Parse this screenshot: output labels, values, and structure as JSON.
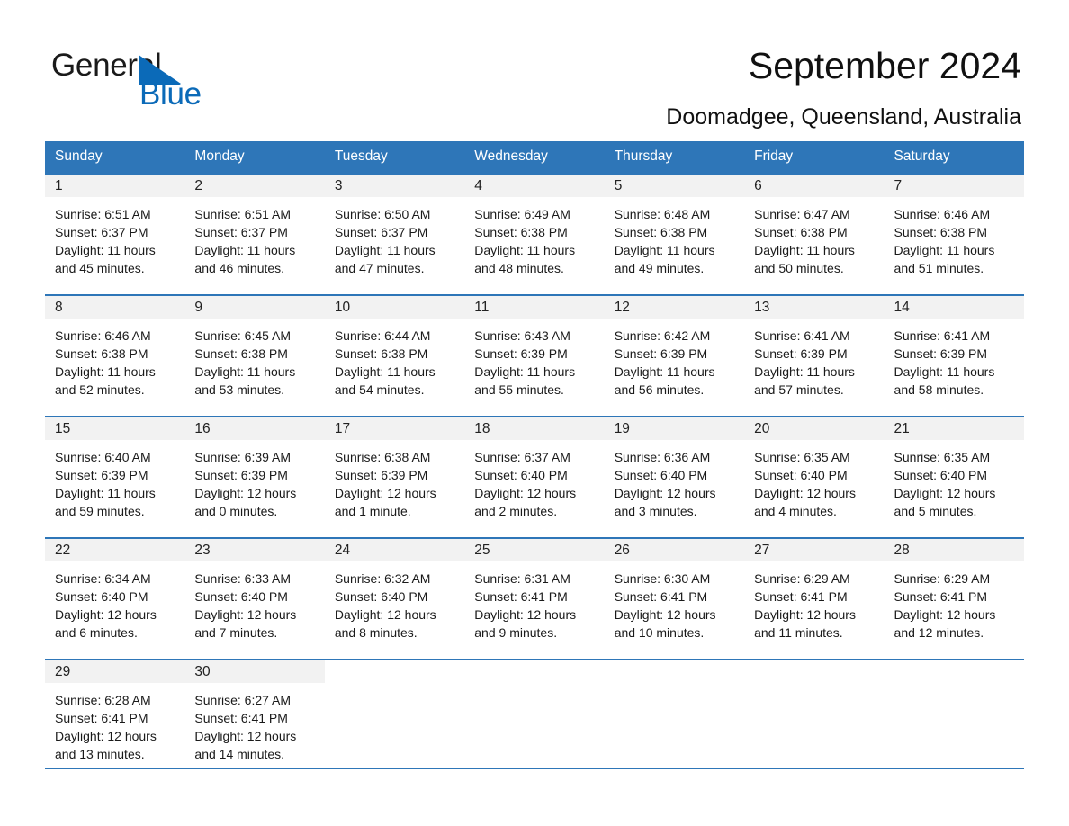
{
  "brand": {
    "word1": "General",
    "word2": "Blue",
    "triangle_color": "#0b6ab8",
    "text_color": "#1a1a1a"
  },
  "header": {
    "title": "September 2024",
    "subtitle": "Doomadgee, Queensland, Australia"
  },
  "theme": {
    "header_blue": "#2e76b8",
    "daynum_bg": "#f2f2f2",
    "page_bg": "#ffffff"
  },
  "weekdays": [
    "Sunday",
    "Monday",
    "Tuesday",
    "Wednesday",
    "Thursday",
    "Friday",
    "Saturday"
  ],
  "labels": {
    "sunrise_prefix": "Sunrise:",
    "sunset_prefix": "Sunset:",
    "daylight_prefix": "Daylight:"
  },
  "weeks": [
    [
      {
        "day": "1",
        "sunrise": "Sunrise: 6:51 AM",
        "sunset": "Sunset: 6:37 PM",
        "daylight_line1": "Daylight: 11 hours",
        "daylight_line2": "and 45 minutes."
      },
      {
        "day": "2",
        "sunrise": "Sunrise: 6:51 AM",
        "sunset": "Sunset: 6:37 PM",
        "daylight_line1": "Daylight: 11 hours",
        "daylight_line2": "and 46 minutes."
      },
      {
        "day": "3",
        "sunrise": "Sunrise: 6:50 AM",
        "sunset": "Sunset: 6:37 PM",
        "daylight_line1": "Daylight: 11 hours",
        "daylight_line2": "and 47 minutes."
      },
      {
        "day": "4",
        "sunrise": "Sunrise: 6:49 AM",
        "sunset": "Sunset: 6:38 PM",
        "daylight_line1": "Daylight: 11 hours",
        "daylight_line2": "and 48 minutes."
      },
      {
        "day": "5",
        "sunrise": "Sunrise: 6:48 AM",
        "sunset": "Sunset: 6:38 PM",
        "daylight_line1": "Daylight: 11 hours",
        "daylight_line2": "and 49 minutes."
      },
      {
        "day": "6",
        "sunrise": "Sunrise: 6:47 AM",
        "sunset": "Sunset: 6:38 PM",
        "daylight_line1": "Daylight: 11 hours",
        "daylight_line2": "and 50 minutes."
      },
      {
        "day": "7",
        "sunrise": "Sunrise: 6:46 AM",
        "sunset": "Sunset: 6:38 PM",
        "daylight_line1": "Daylight: 11 hours",
        "daylight_line2": "and 51 minutes."
      }
    ],
    [
      {
        "day": "8",
        "sunrise": "Sunrise: 6:46 AM",
        "sunset": "Sunset: 6:38 PM",
        "daylight_line1": "Daylight: 11 hours",
        "daylight_line2": "and 52 minutes."
      },
      {
        "day": "9",
        "sunrise": "Sunrise: 6:45 AM",
        "sunset": "Sunset: 6:38 PM",
        "daylight_line1": "Daylight: 11 hours",
        "daylight_line2": "and 53 minutes."
      },
      {
        "day": "10",
        "sunrise": "Sunrise: 6:44 AM",
        "sunset": "Sunset: 6:38 PM",
        "daylight_line1": "Daylight: 11 hours",
        "daylight_line2": "and 54 minutes."
      },
      {
        "day": "11",
        "sunrise": "Sunrise: 6:43 AM",
        "sunset": "Sunset: 6:39 PM",
        "daylight_line1": "Daylight: 11 hours",
        "daylight_line2": "and 55 minutes."
      },
      {
        "day": "12",
        "sunrise": "Sunrise: 6:42 AM",
        "sunset": "Sunset: 6:39 PM",
        "daylight_line1": "Daylight: 11 hours",
        "daylight_line2": "and 56 minutes."
      },
      {
        "day": "13",
        "sunrise": "Sunrise: 6:41 AM",
        "sunset": "Sunset: 6:39 PM",
        "daylight_line1": "Daylight: 11 hours",
        "daylight_line2": "and 57 minutes."
      },
      {
        "day": "14",
        "sunrise": "Sunrise: 6:41 AM",
        "sunset": "Sunset: 6:39 PM",
        "daylight_line1": "Daylight: 11 hours",
        "daylight_line2": "and 58 minutes."
      }
    ],
    [
      {
        "day": "15",
        "sunrise": "Sunrise: 6:40 AM",
        "sunset": "Sunset: 6:39 PM",
        "daylight_line1": "Daylight: 11 hours",
        "daylight_line2": "and 59 minutes."
      },
      {
        "day": "16",
        "sunrise": "Sunrise: 6:39 AM",
        "sunset": "Sunset: 6:39 PM",
        "daylight_line1": "Daylight: 12 hours",
        "daylight_line2": "and 0 minutes."
      },
      {
        "day": "17",
        "sunrise": "Sunrise: 6:38 AM",
        "sunset": "Sunset: 6:39 PM",
        "daylight_line1": "Daylight: 12 hours",
        "daylight_line2": "and 1 minute."
      },
      {
        "day": "18",
        "sunrise": "Sunrise: 6:37 AM",
        "sunset": "Sunset: 6:40 PM",
        "daylight_line1": "Daylight: 12 hours",
        "daylight_line2": "and 2 minutes."
      },
      {
        "day": "19",
        "sunrise": "Sunrise: 6:36 AM",
        "sunset": "Sunset: 6:40 PM",
        "daylight_line1": "Daylight: 12 hours",
        "daylight_line2": "and 3 minutes."
      },
      {
        "day": "20",
        "sunrise": "Sunrise: 6:35 AM",
        "sunset": "Sunset: 6:40 PM",
        "daylight_line1": "Daylight: 12 hours",
        "daylight_line2": "and 4 minutes."
      },
      {
        "day": "21",
        "sunrise": "Sunrise: 6:35 AM",
        "sunset": "Sunset: 6:40 PM",
        "daylight_line1": "Daylight: 12 hours",
        "daylight_line2": "and 5 minutes."
      }
    ],
    [
      {
        "day": "22",
        "sunrise": "Sunrise: 6:34 AM",
        "sunset": "Sunset: 6:40 PM",
        "daylight_line1": "Daylight: 12 hours",
        "daylight_line2": "and 6 minutes."
      },
      {
        "day": "23",
        "sunrise": "Sunrise: 6:33 AM",
        "sunset": "Sunset: 6:40 PM",
        "daylight_line1": "Daylight: 12 hours",
        "daylight_line2": "and 7 minutes."
      },
      {
        "day": "24",
        "sunrise": "Sunrise: 6:32 AM",
        "sunset": "Sunset: 6:40 PM",
        "daylight_line1": "Daylight: 12 hours",
        "daylight_line2": "and 8 minutes."
      },
      {
        "day": "25",
        "sunrise": "Sunrise: 6:31 AM",
        "sunset": "Sunset: 6:41 PM",
        "daylight_line1": "Daylight: 12 hours",
        "daylight_line2": "and 9 minutes."
      },
      {
        "day": "26",
        "sunrise": "Sunrise: 6:30 AM",
        "sunset": "Sunset: 6:41 PM",
        "daylight_line1": "Daylight: 12 hours",
        "daylight_line2": "and 10 minutes."
      },
      {
        "day": "27",
        "sunrise": "Sunrise: 6:29 AM",
        "sunset": "Sunset: 6:41 PM",
        "daylight_line1": "Daylight: 12 hours",
        "daylight_line2": "and 11 minutes."
      },
      {
        "day": "28",
        "sunrise": "Sunrise: 6:29 AM",
        "sunset": "Sunset: 6:41 PM",
        "daylight_line1": "Daylight: 12 hours",
        "daylight_line2": "and 12 minutes."
      }
    ],
    [
      {
        "day": "29",
        "sunrise": "Sunrise: 6:28 AM",
        "sunset": "Sunset: 6:41 PM",
        "daylight_line1": "Daylight: 12 hours",
        "daylight_line2": "and 13 minutes."
      },
      {
        "day": "30",
        "sunrise": "Sunrise: 6:27 AM",
        "sunset": "Sunset: 6:41 PM",
        "daylight_line1": "Daylight: 12 hours",
        "daylight_line2": "and 14 minutes."
      },
      {
        "day": "",
        "sunrise": "",
        "sunset": "",
        "daylight_line1": "",
        "daylight_line2": ""
      },
      {
        "day": "",
        "sunrise": "",
        "sunset": "",
        "daylight_line1": "",
        "daylight_line2": ""
      },
      {
        "day": "",
        "sunrise": "",
        "sunset": "",
        "daylight_line1": "",
        "daylight_line2": ""
      },
      {
        "day": "",
        "sunrise": "",
        "sunset": "",
        "daylight_line1": "",
        "daylight_line2": ""
      },
      {
        "day": "",
        "sunrise": "",
        "sunset": "",
        "daylight_line1": "",
        "daylight_line2": ""
      }
    ]
  ]
}
